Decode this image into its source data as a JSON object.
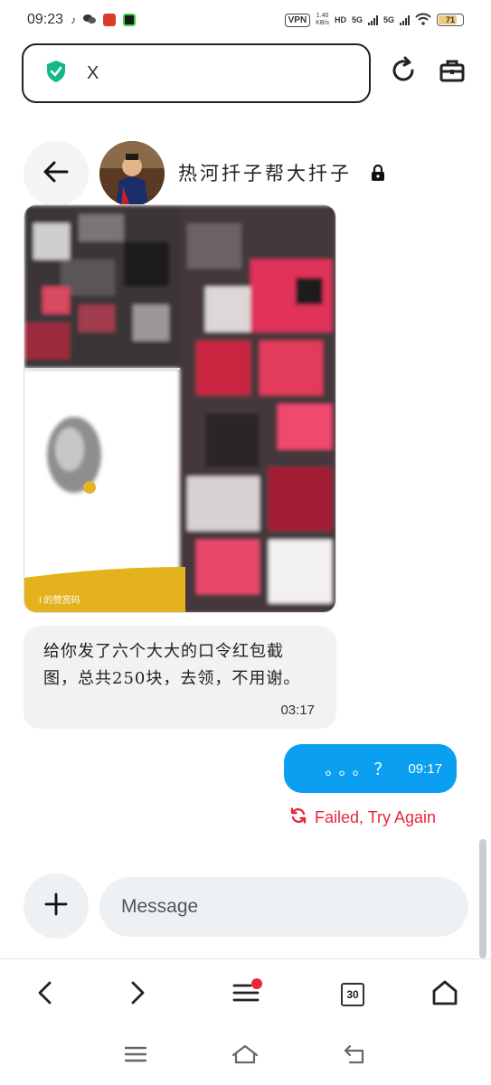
{
  "status_bar": {
    "time": "09:23",
    "vpn": "VPN",
    "net_speed_value": "1.40",
    "net_speed_unit": "KB/s",
    "hd": "HD",
    "sim1_network": "5G",
    "sim2_network": "5G",
    "battery_level": "71",
    "colors": {
      "app1": "#d93a2a",
      "app2": "#1a1a1a"
    }
  },
  "browser": {
    "url_text": "X",
    "shield_color": "#12b886",
    "icons": [
      "shield-check-icon",
      "refresh-icon",
      "briefcase-icon"
    ]
  },
  "chat": {
    "title": "热河扦子帮大扦子",
    "locked": true,
    "image_caption": "I 的赞赏码",
    "received_message": {
      "text": "给你发了六个大大的口令红包截图，总共250块，去领，不用谢。",
      "time": "03:17"
    },
    "sent_message": {
      "text": "。。。？",
      "time": "09:17",
      "bubble_color": "#0a9ff0"
    },
    "failed_label": "Failed, Try Again",
    "failed_color": "#e8263a"
  },
  "composer": {
    "placeholder": "Message"
  },
  "toolbar": {
    "tab_count": "30",
    "menu_has_badge": true
  }
}
